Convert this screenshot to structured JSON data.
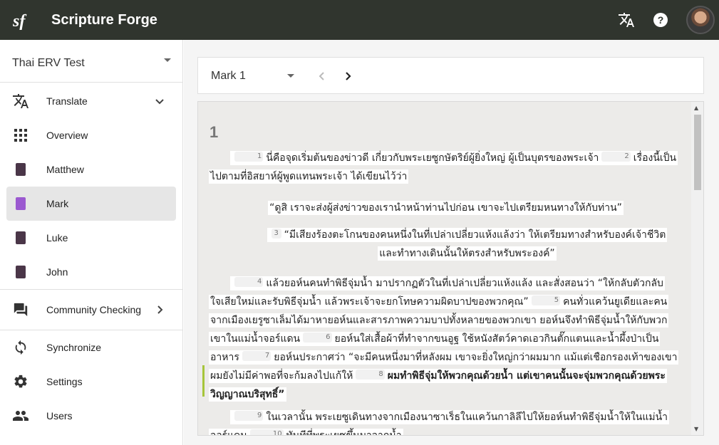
{
  "app": {
    "title": "Scripture Forge"
  },
  "topbar": {
    "icons": [
      "translate-icon",
      "help-icon"
    ],
    "avatar": "user-avatar"
  },
  "sidebar": {
    "project": "Thai ERV Test",
    "items": [
      {
        "label": "Translate",
        "icon": "translate-icon",
        "trail": "expand-less"
      },
      {
        "label": "Overview",
        "icon": "grid-icon"
      },
      {
        "label": "Matthew",
        "icon": "book-icon"
      },
      {
        "label": "Mark",
        "icon": "book-icon",
        "active": true
      },
      {
        "label": "Luke",
        "icon": "book-icon"
      },
      {
        "label": "John",
        "icon": "book-icon"
      },
      {
        "label": "Community Checking",
        "icon": "forum-icon",
        "trail": "chevron-right"
      },
      {
        "label": "Synchronize",
        "icon": "sync-icon"
      },
      {
        "label": "Settings",
        "icon": "gear-icon"
      },
      {
        "label": "Users",
        "icon": "people-icon"
      }
    ]
  },
  "chapter": {
    "label": "Mark 1"
  },
  "editor": {
    "chapter_number": "1",
    "verses": {
      "v1": "1",
      "p1_a": "นี่คือจุดเริ่มต้นของข่าวดี เกี่ยวกับพระเยซูกษัตริย์ผู้ยิ่งใหญ่ ผู้เป็นบุตรของพระเจ้า",
      "v2": "2",
      "p1_b": "เรื่องนี้เป็นไปตามที่อิสยาห์ผู้พูดแทนพระเจ้า ได้เขียนไว้ว่า",
      "q1": "“ดูสิ เราจะส่งผู้ส่งข่าวของเรานำหน้าท่านไปก่อน เขาจะไปเตรียมหนทางให้กับท่าน”",
      "v3": "3",
      "q2": "“มีเสียงร้องตะโกนของคนหนึ่งในที่เปล่าเปลี่ยวแห้งแล้งว่า ให้เตรียมทางสำหรับองค์เจ้าชีวิต และทำทางเดินนั้นให้ตรงสำหรับพระองค์”",
      "v4": "4",
      "p2_a": "แล้วยอห์นคนทำพิธีจุ่มน้ำ มาปรากฏตัวในที่เปล่าเปลี่ยวแห้งแล้ง และสั่งสอนว่า “ให้กลับตัวกลับใจเสียใหม่และรับพิธีจุ่มน้ำ แล้วพระเจ้าจะยกโทษความผิดบาปของพวกคุณ”",
      "v5": "5",
      "p2_b": "คนทั่วแคว้นยูเดียและคนจากเมืองเยรูซาเล็มได้มาหายอห์นและสารภาพความบาปทั้งหลายของพวกเขา ยอห์นจึงทำพิธีจุ่มน้ำให้กับพวกเขาในแม่น้ำจอร์แดน",
      "v6": "6",
      "p2_c": "ยอห์นใส่เสื้อผ้าที่ทำจากขนอูฐ ใช้หนังสัตว์คาดเอวกินตั๊กแตนและน้ำผึ้งป่าเป็นอาหาร",
      "v7": "7",
      "p2_d": "ยอห์นประกาศว่า “จะมีคนหนึ่งมาที่หลังผม เขาจะยิ่งใหญ่กว่าผมมาก แม้แต่เชือกรองเท้าของเขา ผมยังไม่มีค่าพอที่จะก้มลงไปแก้ให้",
      "v8": "8",
      "p2_e": "ผมทำพิธีจุ่มให้พวกคุณด้วยน้ำ แต่เขาคนนั้นจะจุ่มพวกคุณด้วยพระวิญญาณบริสุทธิ์”",
      "v9": "9",
      "p3_a": "ในเวลานั้น พระเยซูเดินทางจากเมืองนาซาเร็ธในแคว้นกาลิลีไปให้ยอห์นทำพิธีจุ่มน้ำให้ในแม่น้ำจอร์แดน",
      "v10": "10",
      "p3_b": "ทันทีที่พระเยซูขึ้นมาจากน้ำ"
    }
  },
  "colors": {
    "topbar": "#30352e",
    "active_book": "#9b59d0",
    "change_marker": "#a6c53a"
  }
}
